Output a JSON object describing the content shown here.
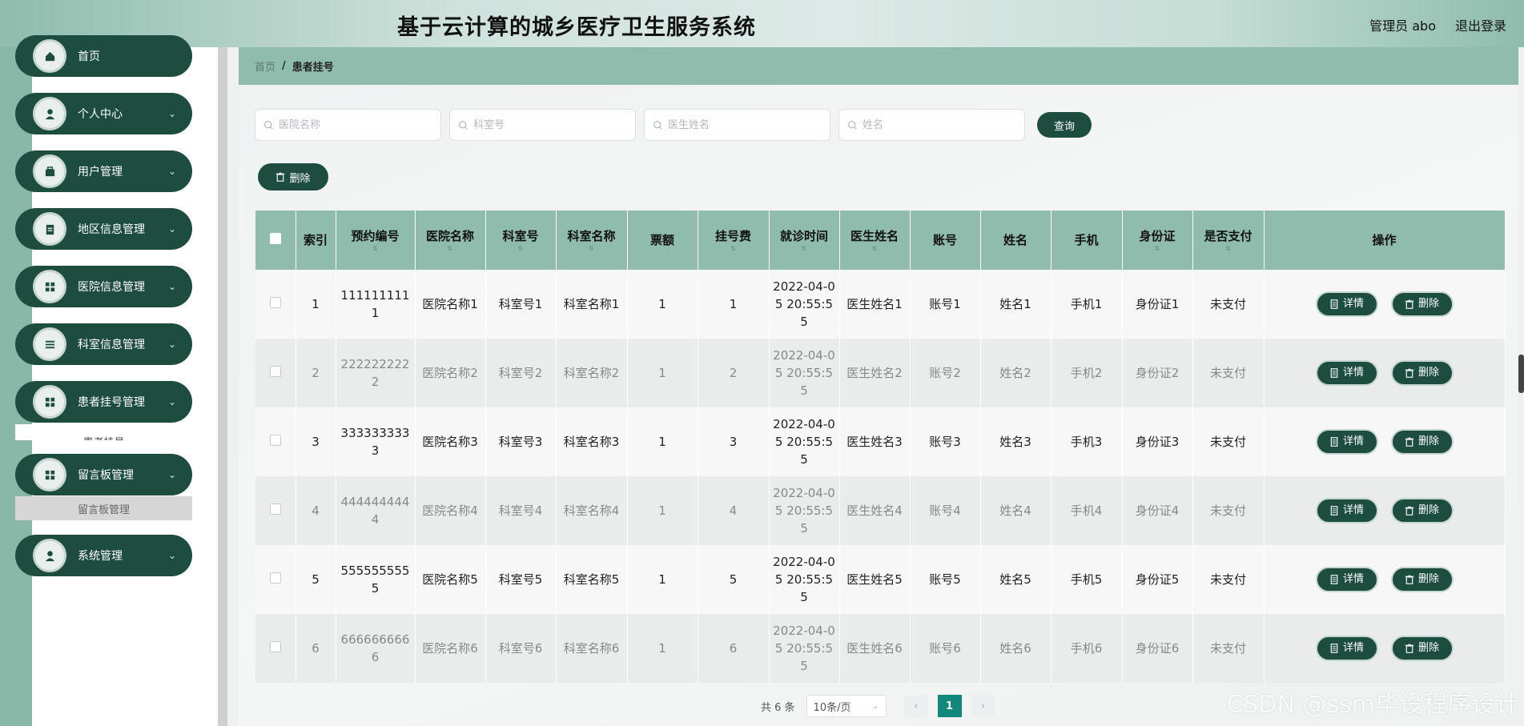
{
  "header": {
    "title": "基于云计算的城乡医疗卫生服务系统",
    "admin": "管理员 abo",
    "logout": "退出登录"
  },
  "sidebar": {
    "items": [
      {
        "label": "首页",
        "icon": "home-icon",
        "chevron": ""
      },
      {
        "label": "个人中心",
        "icon": "user-icon",
        "chevron": "⌄"
      },
      {
        "label": "用户管理",
        "icon": "briefcase-icon",
        "chevron": "⌄"
      },
      {
        "label": "地区信息管理",
        "icon": "clipboard-icon",
        "chevron": "⌄"
      },
      {
        "label": "医院信息管理",
        "icon": "grid-icon",
        "chevron": "⌄"
      },
      {
        "label": "科室信息管理",
        "icon": "list-icon",
        "chevron": "⌄"
      },
      {
        "label": "患者挂号管理",
        "icon": "grid-icon",
        "chevron": "⌄"
      },
      {
        "label": "留言板管理",
        "icon": "grid-icon",
        "chevron": "⌄"
      },
      {
        "label": "系统管理",
        "icon": "user-icon",
        "chevron": "⌄"
      }
    ],
    "submenu_active": "留言板管理"
  },
  "breadcrumb": {
    "home": "首页",
    "separator": "/",
    "current": "患者挂号"
  },
  "search": {
    "hospital_placeholder": "医院名称",
    "room_no_placeholder": "科室号",
    "doctor_placeholder": "医生姓名",
    "name_placeholder": "姓名",
    "query_label": "查询"
  },
  "toolbar": {
    "delete_label": "删除"
  },
  "table": {
    "headers": [
      "索引",
      "预约编号",
      "医院名称",
      "科室号",
      "科室名称",
      "票额",
      "挂号费",
      "就诊时间",
      "医生姓名",
      "账号",
      "姓名",
      "手机",
      "身份证",
      "是否支付",
      "操作"
    ],
    "detail_label": "详情",
    "delete_label": "删除",
    "rows": [
      {
        "idx": "1",
        "no": "1111111111",
        "hospital": "医院名称1",
        "room_no": "科室号1",
        "room": "科室名称1",
        "ticket": "1",
        "fee": "1",
        "time": "2022-04-05 20:55:55",
        "doctor": "医生姓名1",
        "account": "账号1",
        "name": "姓名1",
        "phone": "手机1",
        "id": "身份证1",
        "paid": "未支付"
      },
      {
        "idx": "2",
        "no": "2222222222",
        "hospital": "医院名称2",
        "room_no": "科室号2",
        "room": "科室名称2",
        "ticket": "1",
        "fee": "2",
        "time": "2022-04-05 20:55:55",
        "doctor": "医生姓名2",
        "account": "账号2",
        "name": "姓名2",
        "phone": "手机2",
        "id": "身份证2",
        "paid": "未支付"
      },
      {
        "idx": "3",
        "no": "3333333333",
        "hospital": "医院名称3",
        "room_no": "科室号3",
        "room": "科室名称3",
        "ticket": "1",
        "fee": "3",
        "time": "2022-04-05 20:55:55",
        "doctor": "医生姓名3",
        "account": "账号3",
        "name": "姓名3",
        "phone": "手机3",
        "id": "身份证3",
        "paid": "未支付"
      },
      {
        "idx": "4",
        "no": "4444444444",
        "hospital": "医院名称4",
        "room_no": "科室号4",
        "room": "科室名称4",
        "ticket": "1",
        "fee": "4",
        "time": "2022-04-05 20:55:55",
        "doctor": "医生姓名4",
        "account": "账号4",
        "name": "姓名4",
        "phone": "手机4",
        "id": "身份证4",
        "paid": "未支付"
      },
      {
        "idx": "5",
        "no": "5555555555",
        "hospital": "医院名称5",
        "room_no": "科室号5",
        "room": "科室名称5",
        "ticket": "1",
        "fee": "5",
        "time": "2022-04-05 20:55:55",
        "doctor": "医生姓名5",
        "account": "账号5",
        "name": "姓名5",
        "phone": "手机5",
        "id": "身份证5",
        "paid": "未支付"
      },
      {
        "idx": "6",
        "no": "6666666666",
        "hospital": "医院名称6",
        "room_no": "科室号6",
        "room": "科室名称6",
        "ticket": "1",
        "fee": "6",
        "time": "2022-04-05 20:55:55",
        "doctor": "医生姓名6",
        "account": "账号6",
        "name": "姓名6",
        "phone": "手机6",
        "id": "身份证6",
        "paid": "未支付"
      }
    ]
  },
  "pager": {
    "total": "共 6 条",
    "page_size": "10条/页",
    "prev": "‹",
    "current": "1",
    "next": "›"
  },
  "watermark": "CSDN @ssm毕设程序设计",
  "colors": {
    "primary": "#1d4d3f",
    "accent": "#8fbcad",
    "page_active": "#12887a"
  }
}
